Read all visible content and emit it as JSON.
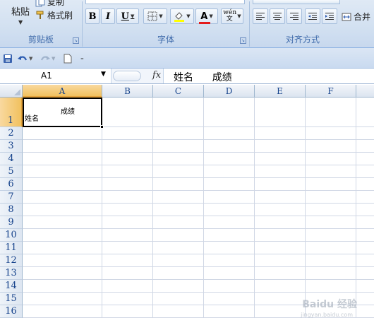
{
  "ribbon": {
    "clipboard": {
      "paste_label": "粘贴",
      "copy_label": "复制",
      "format_painter_label": "格式刷",
      "group_label": "剪贴板"
    },
    "font": {
      "group_label": "字体",
      "bold": "B",
      "italic": "I",
      "underline": "U",
      "font_color_glyph": "A",
      "phonetic_glyph": "wén 文"
    },
    "alignment": {
      "group_label": "对齐方式",
      "merge_label": "合并"
    }
  },
  "qat": {
    "save_icon": "save-icon",
    "undo_icon": "undo-icon",
    "redo_icon": "redo-icon",
    "new_icon": "new-document-icon"
  },
  "formula_bar": {
    "name_box": "A1",
    "fx_label": "fx",
    "content": "姓名      成绩"
  },
  "grid": {
    "columns": [
      "A",
      "B",
      "C",
      "D",
      "E",
      "F"
    ],
    "rows": [
      "1",
      "2",
      "3",
      "4",
      "5",
      "6",
      "7",
      "8",
      "9",
      "10",
      "11",
      "12",
      "13",
      "14",
      "15",
      "16"
    ],
    "selected_cell": "A1",
    "cell_a1": {
      "line1": "成绩",
      "line2": "姓名"
    }
  },
  "watermark": {
    "text": "Baidu 经验",
    "sub": "jingyan.baidu.com"
  }
}
